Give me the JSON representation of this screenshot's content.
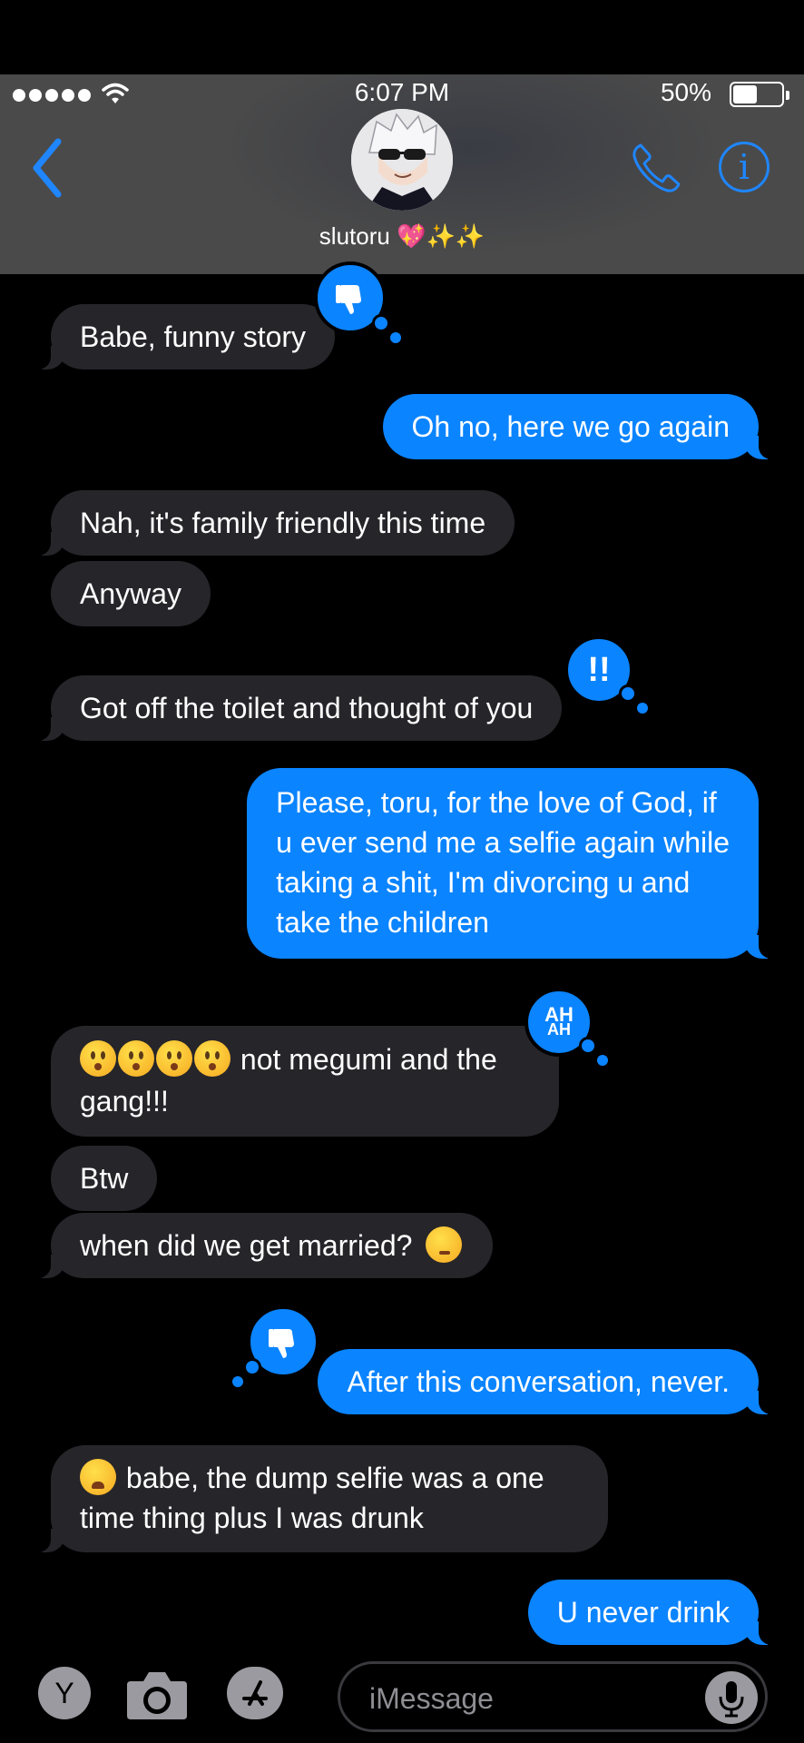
{
  "status_bar": {
    "time": "6:07 PM",
    "battery": "50%"
  },
  "header": {
    "contact_name": "slutoru",
    "name_emojis": "💖✨✨"
  },
  "messages": [
    {
      "side": "in",
      "text": "Babe, funny story",
      "reaction": "dislike"
    },
    {
      "side": "out",
      "text": "Oh no, here we go again"
    },
    {
      "side": "in",
      "text": "Nah, it's family friendly this time"
    },
    {
      "side": "in",
      "text": "Anyway"
    },
    {
      "side": "in",
      "text": "Got off the toilet and thought of you",
      "reaction": "!!"
    },
    {
      "side": "out",
      "lines": [
        "Please, toru, for the love of God, if",
        "u ever send me a selfie again while",
        "taking a shit, I'm divorcing u and",
        "take the children"
      ]
    },
    {
      "side": "in",
      "line1": "not megumi and the",
      "line2": "gang!!!",
      "reaction": "AH AH"
    },
    {
      "side": "in",
      "text": "Btw"
    },
    {
      "side": "in",
      "text": "when did we get married?"
    },
    {
      "side": "out",
      "text": "After this conversation, never.",
      "reaction": "dislike"
    },
    {
      "side": "in",
      "line1": "babe, the dump selfie was a one",
      "line2": "time thing plus I was drunk"
    },
    {
      "side": "out",
      "text": "U never drink"
    }
  ],
  "reactions": {
    "exclaim": "!!",
    "haha_top": "AH",
    "haha_bottom": "AH"
  },
  "toolbar": {
    "app_letter": "Y",
    "placeholder": "iMessage"
  },
  "colors": {
    "outgoing": "#0b84ff",
    "incoming": "#26252a",
    "header": "#4a4a4a",
    "accent": "#1f86ff"
  }
}
